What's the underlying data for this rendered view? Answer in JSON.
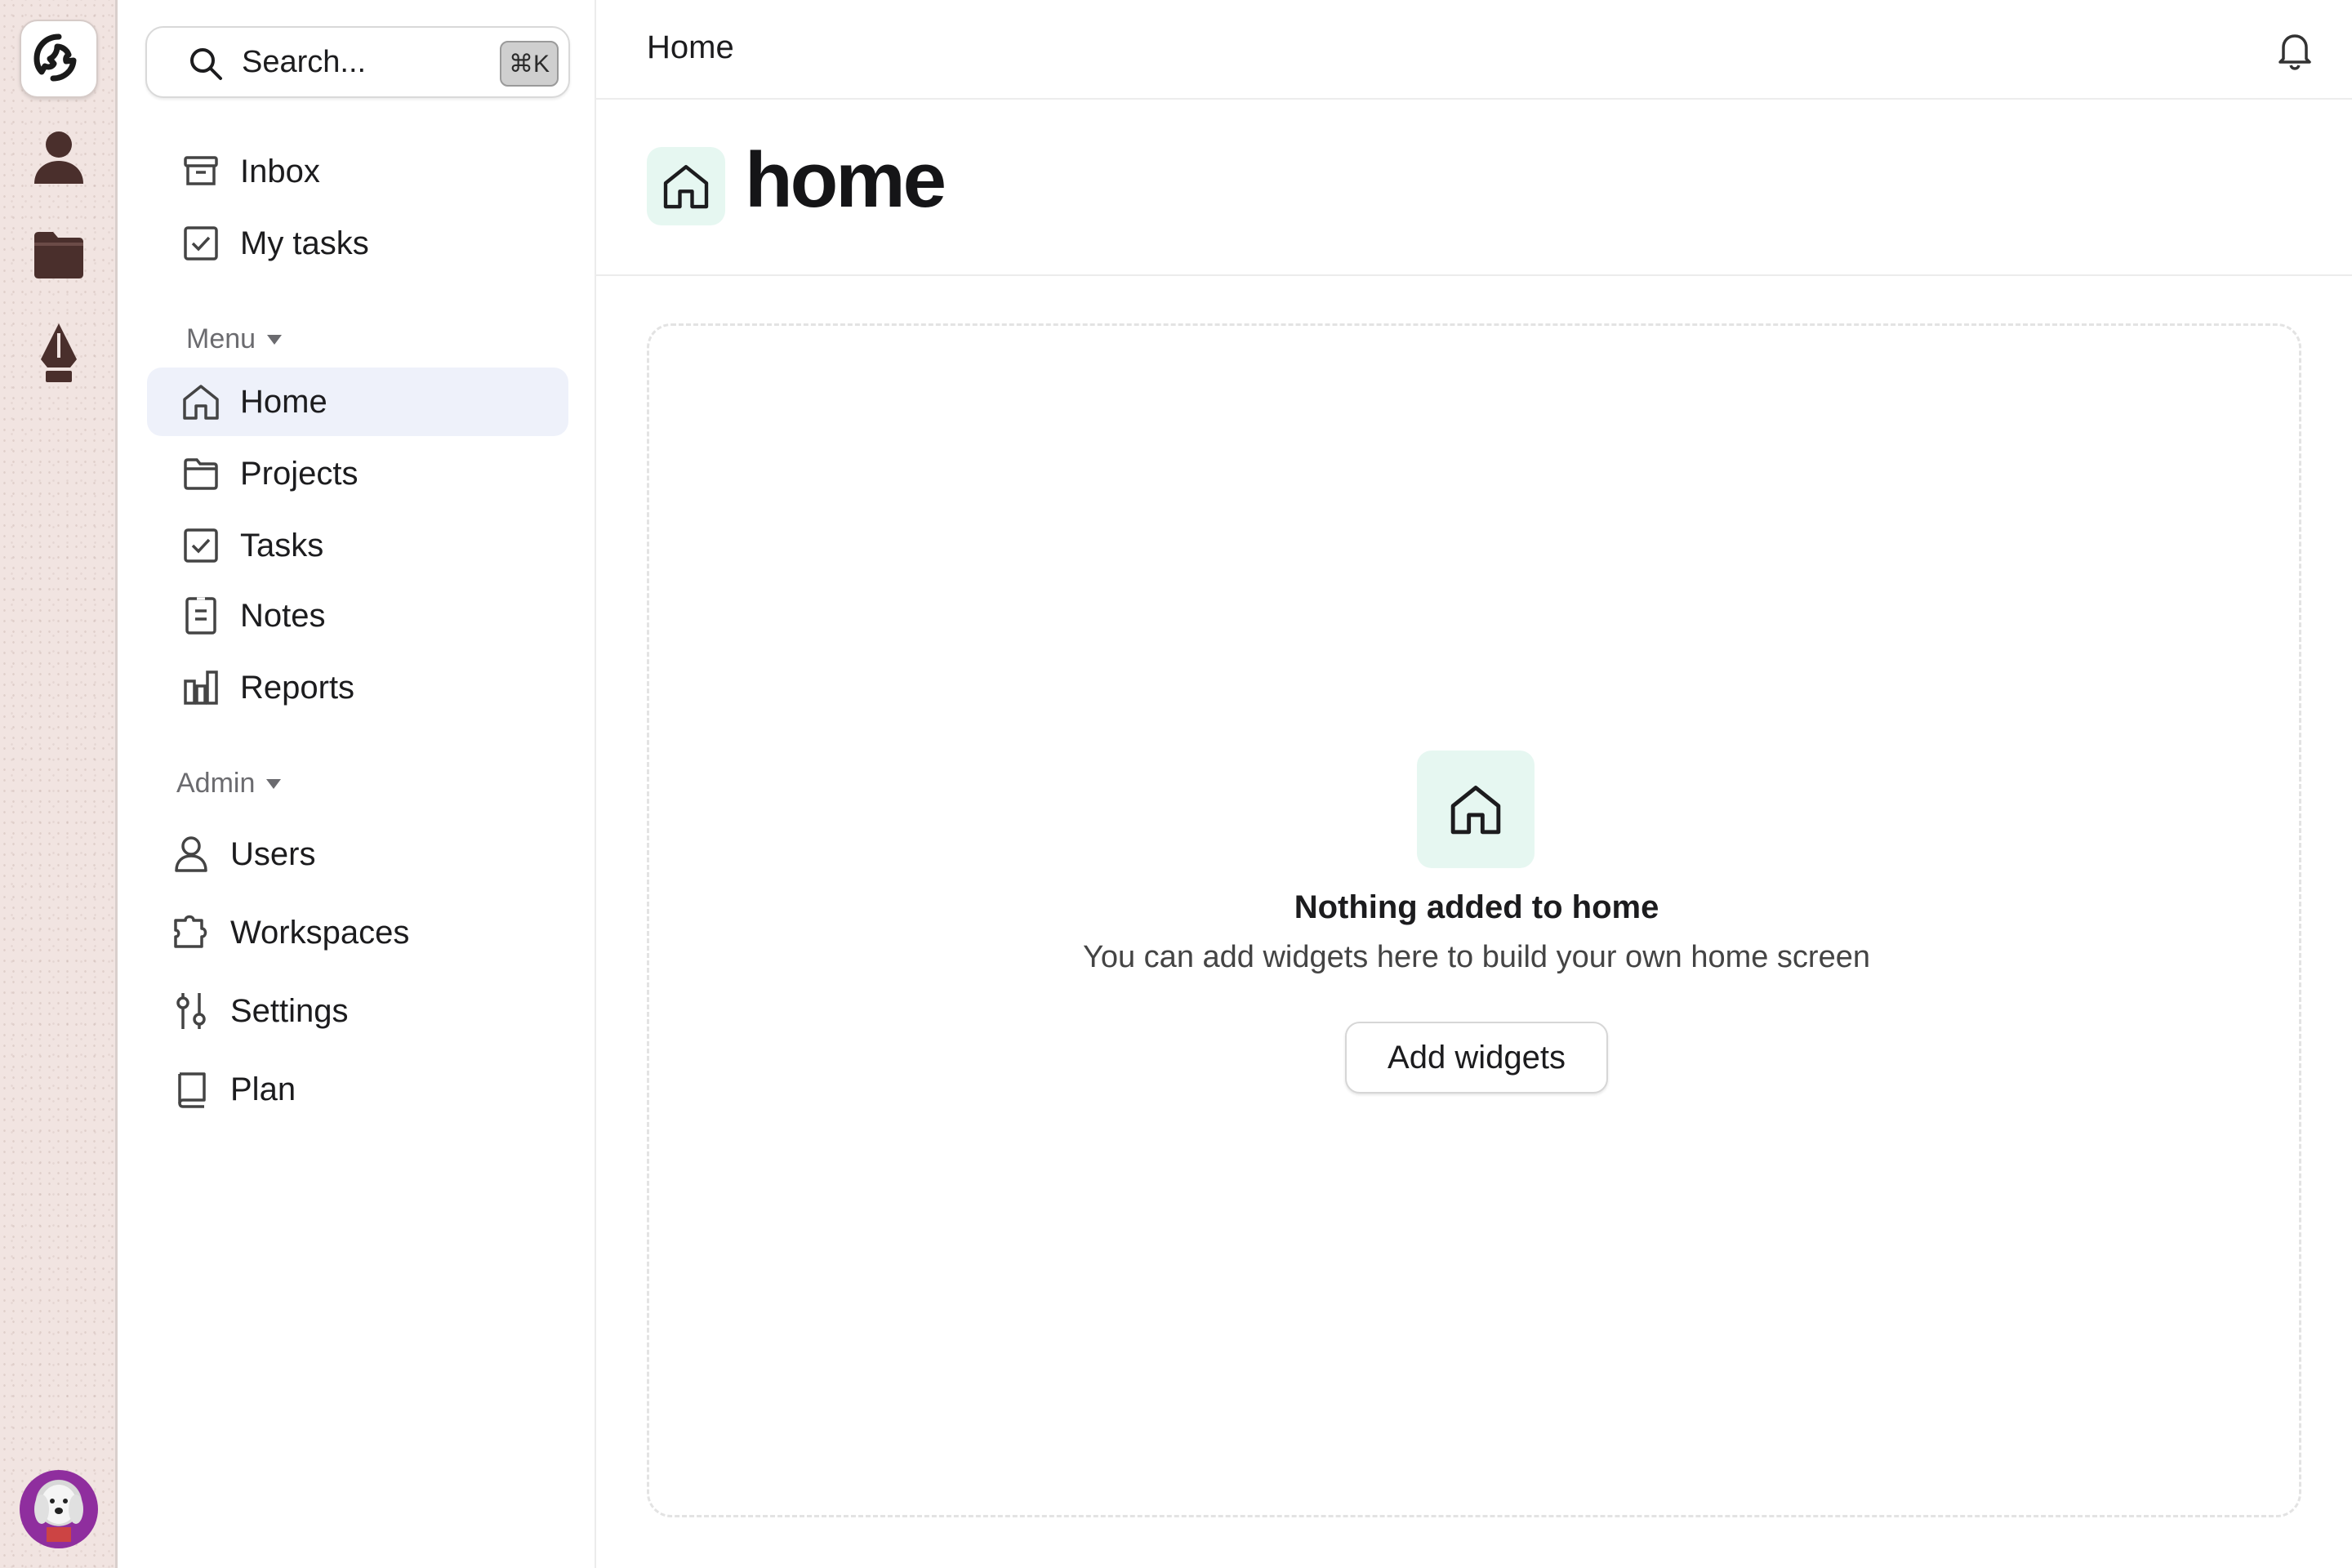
{
  "rail": {
    "items": [
      {
        "name": "app-logo",
        "icon": "dog-logo-icon"
      },
      {
        "name": "profile",
        "icon": "person-icon"
      },
      {
        "name": "folder",
        "icon": "folder-icon"
      },
      {
        "name": "pen",
        "icon": "pen-nib-icon"
      }
    ],
    "avatar": "avatar"
  },
  "sidebar": {
    "search": {
      "placeholder": "Search...",
      "shortcut": "⌘K"
    },
    "top_items": [
      {
        "label": "Inbox",
        "icon": "archive-icon"
      },
      {
        "label": "My tasks",
        "icon": "checkbox-icon"
      }
    ],
    "menu": {
      "label": "Menu",
      "items": [
        {
          "label": "Home",
          "icon": "home-icon",
          "active": true
        },
        {
          "label": "Projects",
          "icon": "folder-icon"
        },
        {
          "label": "Tasks",
          "icon": "checkbox-icon"
        },
        {
          "label": "Notes",
          "icon": "notes-icon"
        },
        {
          "label": "Reports",
          "icon": "reports-icon"
        }
      ]
    },
    "admin": {
      "label": "Admin",
      "items": [
        {
          "label": "Users",
          "icon": "user-icon"
        },
        {
          "label": "Workspaces",
          "icon": "puzzle-icon"
        },
        {
          "label": "Settings",
          "icon": "sliders-icon"
        },
        {
          "label": "Plan",
          "icon": "book-icon"
        }
      ]
    }
  },
  "topbar": {
    "breadcrumb": "Home",
    "notification_icon": "bell-icon"
  },
  "header": {
    "title": "home",
    "icon": "home-icon"
  },
  "empty_state": {
    "title": "Nothing added to home",
    "subtitle": "You can add widgets here to build your own home screen",
    "button_label": "Add widgets"
  },
  "colors": {
    "accent_bg": "#e6f7f1",
    "active_nav_bg": "#eef1fa",
    "rail_bg": "#f1e4e1"
  }
}
